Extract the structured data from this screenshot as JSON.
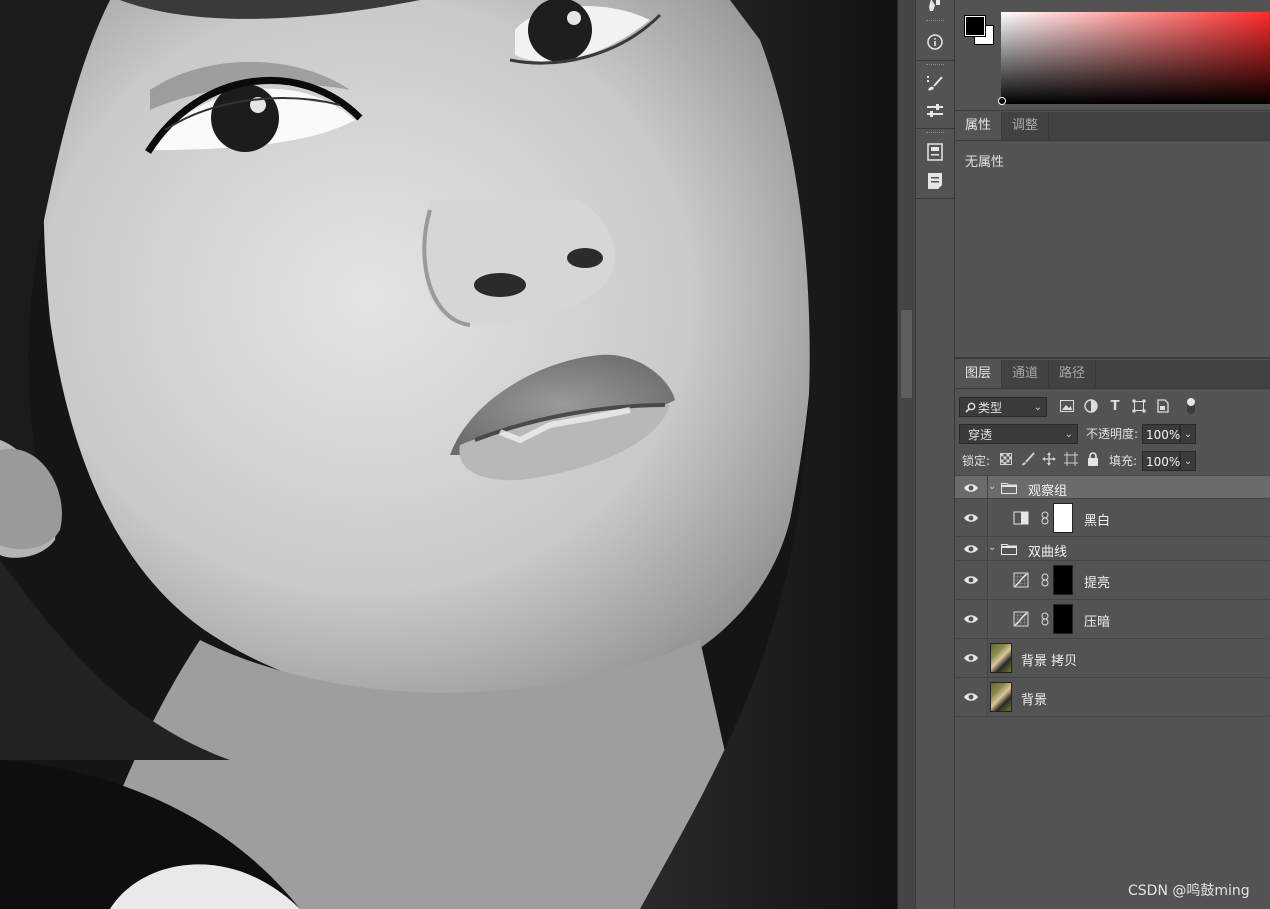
{
  "properties_panel": {
    "tabs": [
      {
        "label": "属性"
      },
      {
        "label": "调整"
      }
    ],
    "body_text": "无属性"
  },
  "layers_panel": {
    "tabs": [
      {
        "label": "图层"
      },
      {
        "label": "通道"
      },
      {
        "label": "路径"
      }
    ],
    "filter_kind": "类型",
    "blend_mode": "穿透",
    "opacity_label": "不透明度:",
    "opacity_value": "100%",
    "lock_label": "锁定:",
    "fill_label": "填充:",
    "fill_value": "100%",
    "layers": [
      {
        "name": "观察组",
        "type": "group",
        "expanded": true,
        "visible": true,
        "selected": true
      },
      {
        "name": "黑白",
        "type": "adjustment",
        "adjustment": "black-white",
        "mask": "white",
        "visible": true
      },
      {
        "name": "双曲线",
        "type": "group",
        "expanded": true,
        "visible": true
      },
      {
        "name": "提亮",
        "type": "adjustment",
        "adjustment": "curves",
        "mask": "black",
        "visible": true
      },
      {
        "name": "压暗",
        "type": "adjustment",
        "adjustment": "curves",
        "mask": "black",
        "visible": true
      },
      {
        "name": "背景 拷贝",
        "type": "pixel",
        "visible": true
      },
      {
        "name": "背景",
        "type": "pixel",
        "visible": true
      }
    ]
  },
  "colors": {
    "foreground": "#000000",
    "background": "#ffffff",
    "picker_hue": "#ff2a2a",
    "panel_bg": "#535353",
    "tab_bar_bg": "#424242",
    "selected_layer_bg": "#6b6b6b"
  },
  "icons": {
    "side_toolbar": [
      "history-brush-icon",
      "info-icon",
      "brush-settings-icon",
      "properties-sliders-icon",
      "libraries-icon",
      "notes-icon"
    ],
    "filters": [
      "image-filter-icon",
      "adjustment-filter-icon",
      "type-filter-icon",
      "shape-filter-icon",
      "smart-object-filter-icon",
      "filter-toggle-icon"
    ],
    "locks": [
      "lock-transparent-icon",
      "lock-pixels-icon",
      "lock-position-icon",
      "lock-artboard-icon",
      "lock-all-icon"
    ]
  },
  "watermark": "CSDN @鸣鼓ming"
}
